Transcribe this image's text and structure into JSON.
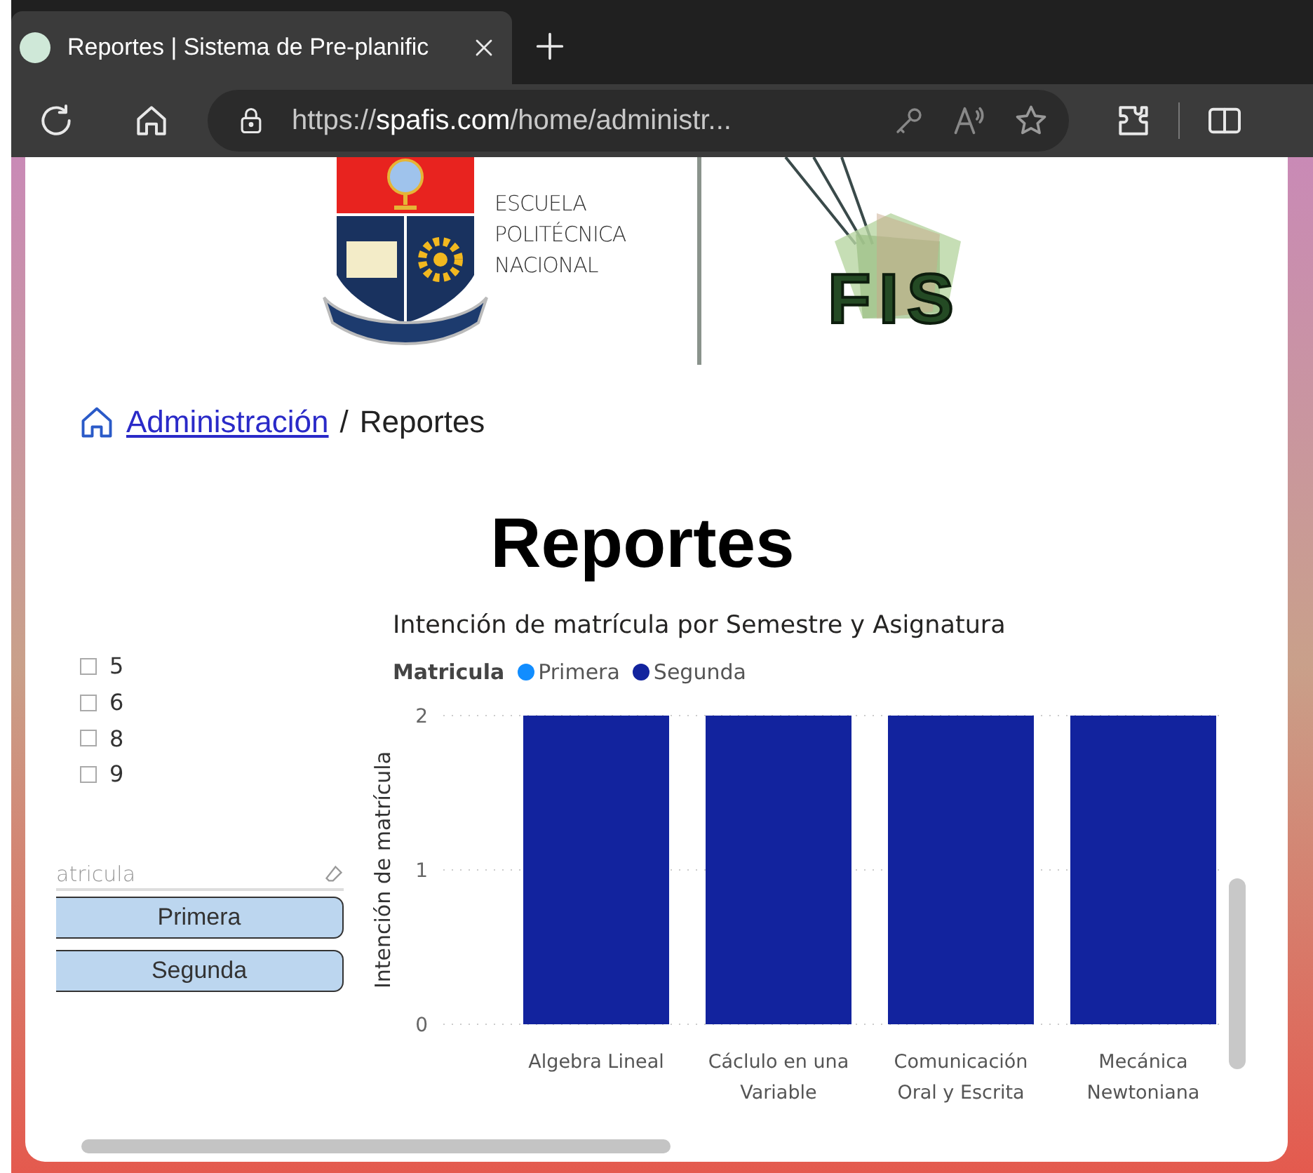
{
  "browser": {
    "tab_title": "Reportes | Sistema de Pre-planific",
    "url_scheme": "https://",
    "url_host": "spafis.com",
    "url_path": "/home/administr..."
  },
  "header": {
    "school_lines": [
      "ESCUELA",
      "POLITÉCNICA",
      "NACIONAL"
    ],
    "faculty_logo": "FIS"
  },
  "breadcrumb": {
    "link": "Administración",
    "separator": "/",
    "current": "Reportes"
  },
  "title": "Reportes",
  "semester_filter": [
    {
      "label": "5",
      "checked": false
    },
    {
      "label": "6",
      "checked": false
    },
    {
      "label": "8",
      "checked": false
    },
    {
      "label": "9",
      "checked": false
    }
  ],
  "matricula_slicer": {
    "title": "atricula",
    "options": [
      {
        "label": "Primera",
        "selected": false
      },
      {
        "label": "Segunda",
        "selected": false
      }
    ]
  },
  "chart": {
    "legend_title": "Matricula",
    "chart_data": {
      "type": "bar",
      "title": "Intención de matrícula por Semestre y Asignatura",
      "ylabel": "Intención de matrícula",
      "categories": [
        "Algebra Lineal",
        "Cáclulo en una Variable",
        "Comunicación Oral y Escrita",
        "Mecánica Newtoniana"
      ],
      "series": [
        {
          "name": "Primera",
          "color": "#118dff",
          "values": [
            null,
            null,
            null,
            null
          ]
        },
        {
          "name": "Segunda",
          "color": "#12239e",
          "values": [
            2,
            2,
            2,
            2
          ]
        }
      ],
      "ylim": [
        0,
        2
      ],
      "yticks": [
        0,
        1,
        2
      ]
    }
  }
}
